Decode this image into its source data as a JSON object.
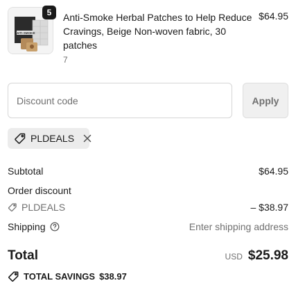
{
  "product": {
    "quantity": "5",
    "title": "Anti-Smoke Herbal Patches to Help Reduce Cravings, Beige Non-woven fabric, 30 patches",
    "variant": "7",
    "price": "$64.95",
    "image_text": "ANTI-SMOKE"
  },
  "discount": {
    "placeholder": "Discount code",
    "apply_label": "Apply"
  },
  "applied_code": {
    "code": "PLDEALS"
  },
  "summary": {
    "subtotal_label": "Subtotal",
    "subtotal_value": "$64.95",
    "order_discount_label": "Order discount",
    "discount_code": "PLDEALS",
    "discount_value": "– $38.97",
    "shipping_label": "Shipping",
    "shipping_value": "Enter shipping address"
  },
  "total": {
    "label": "Total",
    "currency": "USD",
    "amount": "$25.98"
  },
  "savings": {
    "label": "TOTAL SAVINGS",
    "amount": "$38.97"
  },
  "colors": {
    "text": "#1a1a1a",
    "muted": "#707070",
    "chip_bg": "#ececec",
    "badge_bg": "#1a1a1a"
  }
}
